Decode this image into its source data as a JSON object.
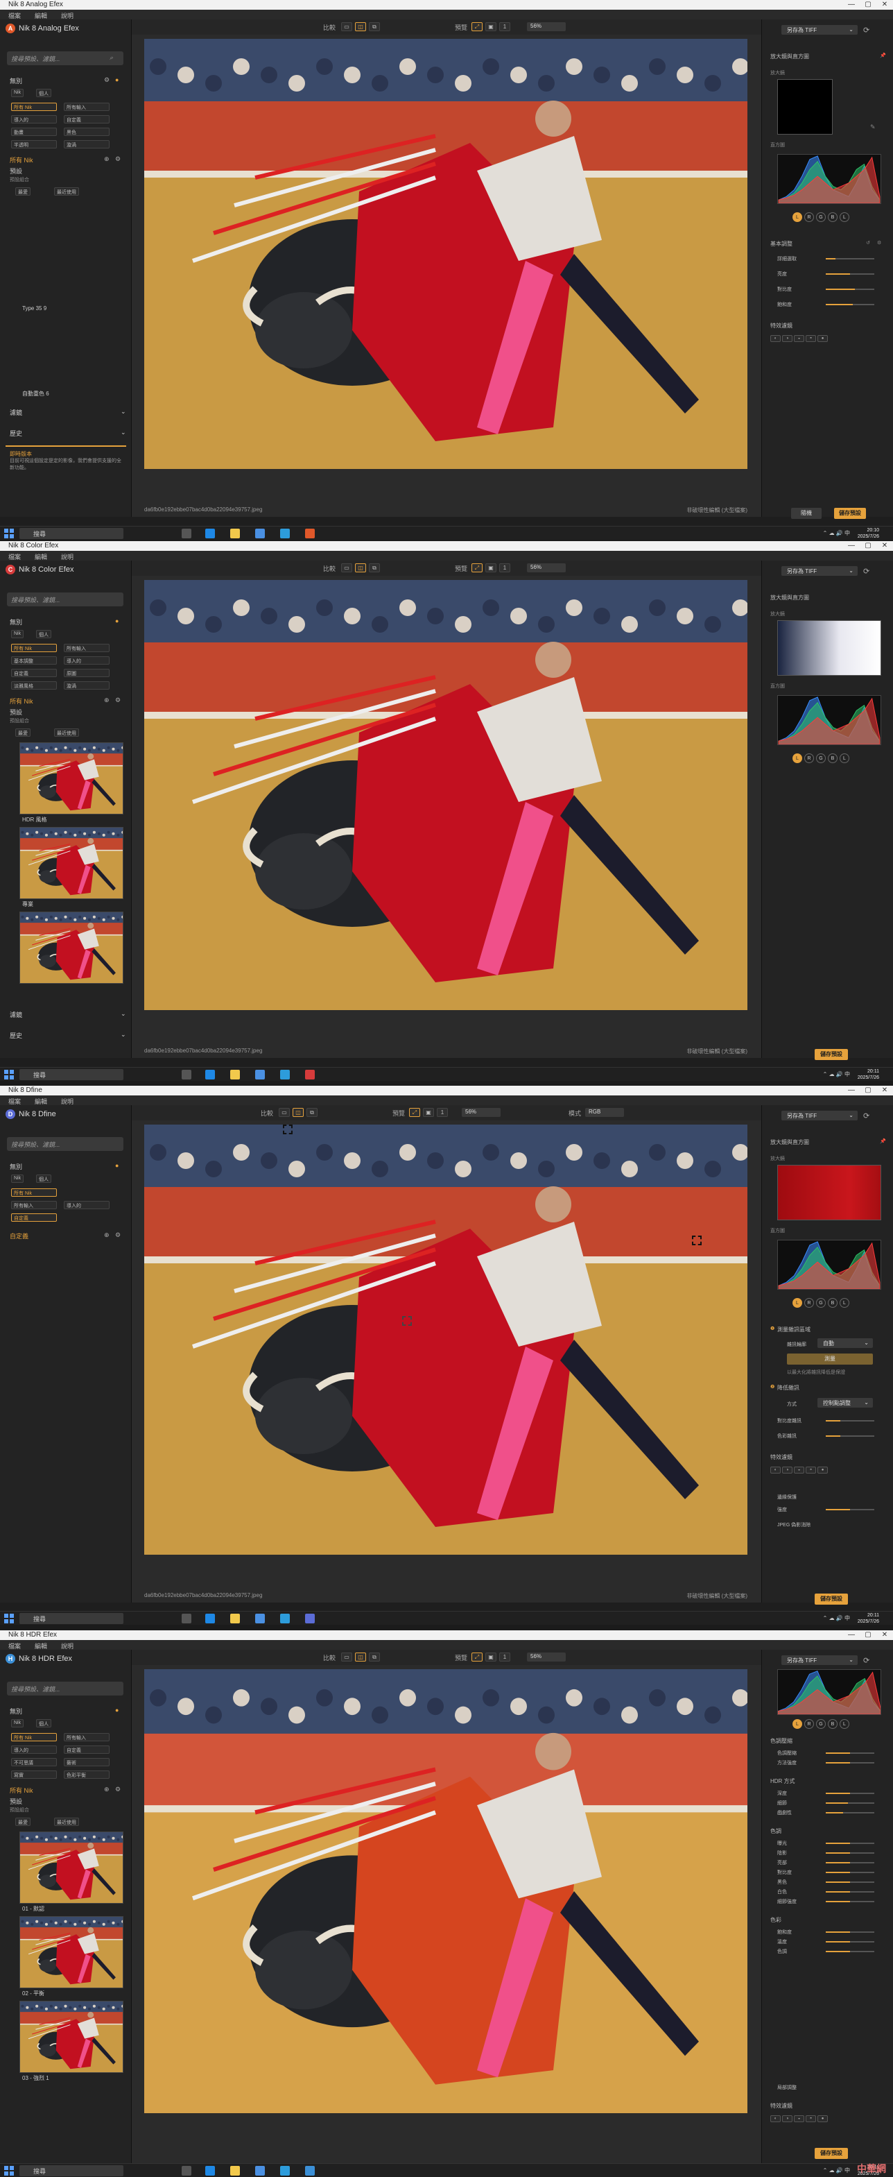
{
  "common": {
    "menu": [
      "檔案",
      "編輯",
      "說明"
    ],
    "window_controls": [
      "—",
      "▢",
      "✕"
    ],
    "search_placeholder": "搜尋預設、濾鏡...",
    "compare_label": "比較",
    "preview_label": "預覽",
    "zoom": "56%",
    "save_as": "另存為 TIFF",
    "loupe_title": "放大鏡與直方圖",
    "loupe_sub": "放大鏡",
    "histogram_sub": "直方圖",
    "channels": [
      "L",
      "R",
      "G",
      "B",
      "L"
    ],
    "filename": "da6fb0e192ebbe07bac4d0ba22094e39757.jpeg",
    "file_status": "非破壞性編輯 (大型檔案)",
    "apply_btn": "儲存預設",
    "taskbar_search": "搜尋",
    "watermark": "中華網"
  },
  "windows": [
    {
      "app": "Nik 8 Analog Efex",
      "logo_letter": "A",
      "logo_color": "#e0582a",
      "filter_head": "無別",
      "chips": [
        "Nik",
        "個人"
      ],
      "categories": [
        [
          "所有 Nik",
          "所有輸入"
        ],
        [
          "導入的",
          "自定義"
        ],
        [
          "動畫",
          "黑色"
        ],
        [
          "半透明",
          "漩渦"
        ]
      ],
      "preset_group": "所有 Nik",
      "preset_sub": "預設",
      "preset_note": "預設組合",
      "preset_items": [
        "Type 35 9",
        "自動重色 6"
      ],
      "preset_chips": [
        "最愛",
        "最近使用"
      ],
      "fold_sections": [
        "濾鏡",
        "歷史"
      ],
      "notice_title": "即時版本",
      "notice_text": "目前可視這個設定是定的影像，我們會提供支援的全新功能。",
      "right_sections": [
        "基本調整"
      ],
      "sliders": [
        [
          "詳細選取",
          0.2
        ],
        [
          "亮度",
          0.5
        ],
        [
          "對比度",
          0.6
        ],
        [
          "飽和度",
          0.55
        ]
      ],
      "right_extra": "特效濾鏡",
      "buttons": [
        "隨機",
        "儲存預設"
      ],
      "clock_time": "20:10",
      "clock_date": "2025/7/26"
    },
    {
      "app": "Nik 8 Color Efex",
      "logo_letter": "C",
      "logo_color": "#d63b3b",
      "filter_head": "無別",
      "chips": [
        "Nik",
        "個人"
      ],
      "categories": [
        [
          "所有 Nik",
          "所有輸入"
        ],
        [
          "基本調整",
          "導入的"
        ],
        [
          "自定義",
          "原圖"
        ],
        [
          "淡雅風格",
          "漩渦"
        ]
      ],
      "preset_group": "所有 Nik",
      "preset_sub": "預設",
      "preset_note": "預設組合",
      "preset_items": [
        "HDR 風格",
        "專業"
      ],
      "preset_chips": [
        "最愛",
        "最近使用"
      ],
      "fold_sections": [
        "濾鏡",
        "歷史"
      ],
      "right_extra": "",
      "buttons": [
        "儲存預設"
      ],
      "clock_time": "20:11",
      "clock_date": "2025/7/26"
    },
    {
      "app": "Nik 8 Dfine",
      "logo_letter": "D",
      "logo_color": "#5b6cd6",
      "filter_head": "無別",
      "chips": [
        "Nik",
        "個人"
      ],
      "categories": [
        [
          "所有 Nik",
          "所有輸入"
        ],
        [
          "所有輸入",
          "導入的"
        ],
        [
          "自定義",
          ""
        ]
      ],
      "preset_group": "自定義",
      "mode_label": "模式",
      "mode_value": "RGB",
      "measure_title": "測量雜訊區域",
      "measure_field": "雜訊輪廓",
      "measure_value": "自動",
      "measure_btn": "測量",
      "measure_note": "以最大化將雜訊降低是保證",
      "reduce_title": "降低雜訊",
      "reduce_method": "方式",
      "reduce_value": "控制點調整",
      "sliders": [
        [
          "對比度雜訊",
          1.0
        ],
        [
          "色彩雜訊",
          1.0
        ]
      ],
      "right_extra": "特效濾鏡",
      "extra1": "邊緣保護",
      "extra2": "強度",
      "extra3": "JPEG 偽影消除",
      "buttons": [
        "儲存預設"
      ],
      "clock_time": "20:11",
      "clock_date": "2025/7/26"
    },
    {
      "app": "Nik 8 HDR Efex",
      "logo_letter": "H",
      "logo_color": "#3b8fd6",
      "filter_head": "無別",
      "chips": [
        "Nik",
        "個人"
      ],
      "categories": [
        [
          "所有 Nik",
          "所有輸入"
        ],
        [
          "導入的",
          "自定義"
        ],
        [
          "不可思議",
          "藝術"
        ],
        [
          "寫實",
          "色彩平衡"
        ]
      ],
      "preset_group": "所有 Nik",
      "preset_sub": "預設",
      "preset_note": "預設組合",
      "preset_items": [
        "01 - 默認",
        "02 - 平衡",
        "03 - 強烈 1"
      ],
      "preset_chips": [
        "最愛",
        "最近使用"
      ],
      "right_groups": [
        {
          "title": "色調壓縮",
          "rows": [
            [
              "色調壓縮",
              0.5
            ],
            [
              "方法強度",
              0.5
            ]
          ]
        },
        {
          "title": "HDR 方式",
          "rows": [
            [
              "深度",
              0.5
            ],
            [
              "細節",
              0.45
            ],
            [
              "戲劇性",
              0.35
            ]
          ]
        },
        {
          "title": "色調",
          "rows": [
            [
              "曝光",
              0.5
            ],
            [
              "陰影",
              0.5
            ],
            [
              "亮部",
              0.5
            ],
            [
              "對比度",
              0.5
            ],
            [
              "黑色",
              0.5
            ],
            [
              "白色",
              0.5
            ],
            [
              "細節強度",
              0.5
            ]
          ]
        },
        {
          "title": "色彩",
          "rows": [
            [
              "飽和度",
              0.5
            ],
            [
              "溫度",
              0.5
            ],
            [
              "色調",
              0.5
            ]
          ]
        }
      ],
      "right_extra": "特效濾鏡",
      "extra1": "局部調整",
      "buttons": [
        "儲存預設"
      ],
      "clock_time": "20:11",
      "clock_date": "2025/7/26"
    }
  ]
}
